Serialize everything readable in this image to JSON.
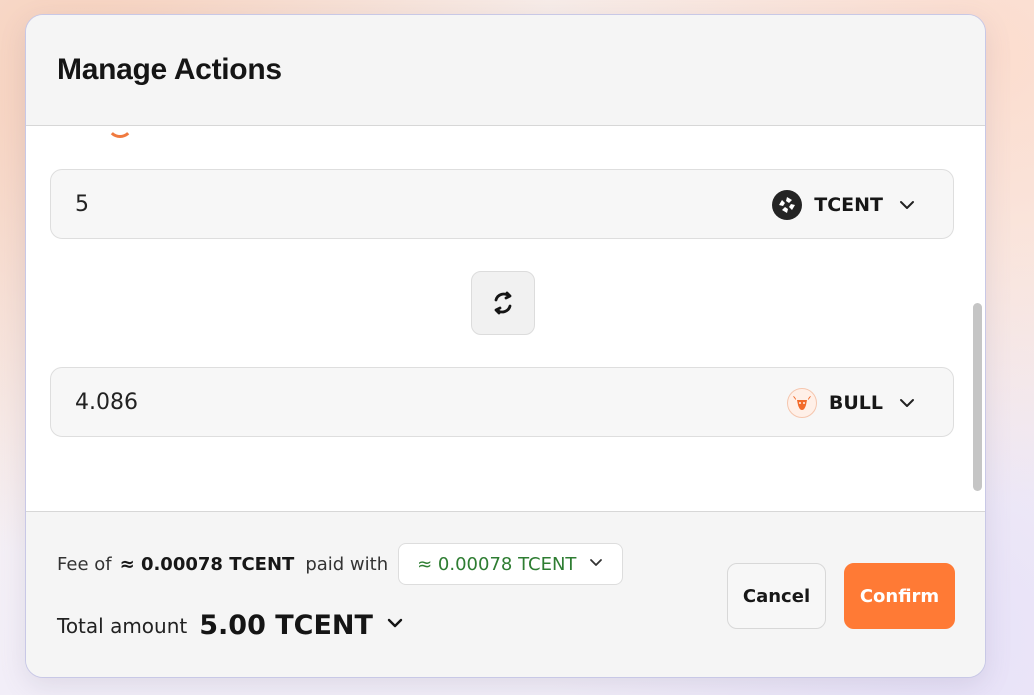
{
  "modal": {
    "title": "Manage Actions"
  },
  "swap": {
    "from": {
      "amount": "5",
      "token": "TCENT",
      "icon": "tcent-token-icon"
    },
    "to": {
      "amount": "4.086",
      "token": "BULL",
      "icon": "bull-token-icon"
    },
    "swap_icon": "swap-direction-icon"
  },
  "footer": {
    "fee_prefix": "Fee of",
    "fee_amount": "≈ 0.00078 TCENT",
    "paid_with_label": "paid with",
    "fee_token_select": "≈ 0.00078 TCENT",
    "total_label": "Total amount",
    "total_value": "5.00 TCENT"
  },
  "buttons": {
    "cancel": "Cancel",
    "confirm": "Confirm"
  },
  "colors": {
    "accent": "#ff7a35",
    "fee_text": "#2e7d32",
    "modal_border": "#c8c8e6"
  }
}
